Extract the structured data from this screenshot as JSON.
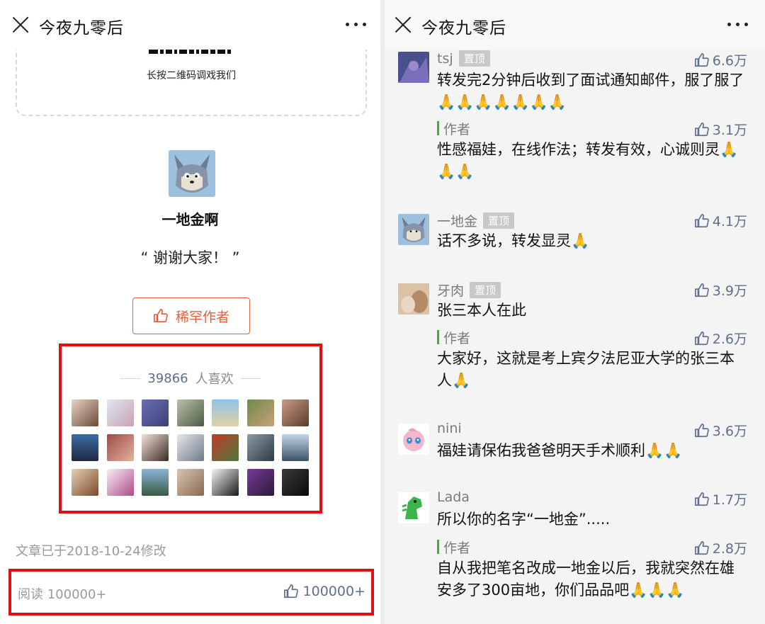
{
  "left": {
    "title": "今夜九零后",
    "qr_caption": "长按二维码调戏我们",
    "author": {
      "name": "一地金啊",
      "quote": "“ 谢谢大家！ ”"
    },
    "appreciate_button": "稀罕作者",
    "likers": {
      "count": "39866",
      "suffix": "人喜欢"
    },
    "edit_note": "文章已于2018-10-24修改",
    "read_label": "阅读 100000+",
    "like_count": "100000+"
  },
  "right": {
    "title": "今夜九零后",
    "pinned_label": "置顶",
    "comments": [
      {
        "name": "tsj",
        "pinned": true,
        "likes": "6.6万",
        "text": "转发完2分钟后收到了面试通知邮件，服了服了🙏🙏🙏🙏🙏🙏🙏",
        "reply": {
          "label": "作者",
          "likes": "3.1万",
          "text": "性感福娃，在线作法；转发有效，心诚则灵🙏🙏🙏"
        }
      },
      {
        "name": "一地金",
        "pinned": true,
        "likes": "4.1万",
        "text": "话不多说，转发显灵🙏"
      },
      {
        "name": "牙肉",
        "pinned": true,
        "likes": "3.9万",
        "text": "张三本人在此",
        "reply": {
          "label": "作者",
          "likes": "2.6万",
          "text": "大家好，这就是考上宾夕法尼亚大学的张三本人🙏"
        }
      },
      {
        "name": "nini",
        "pinned": false,
        "likes": "3.6万",
        "text": "福娃请保佑我爸爸明天手术顺利🙏🙏"
      },
      {
        "name": "Lada",
        "pinned": false,
        "likes": "1.7万",
        "text": "所以你的名字“一地金”.....",
        "reply": {
          "label": "作者",
          "likes": "2.8万",
          "text": "自从我把笔名改成一地金以后，我就突然在雄安多了300亩地，你们品品吧🙏🙏🙏"
        }
      }
    ]
  }
}
